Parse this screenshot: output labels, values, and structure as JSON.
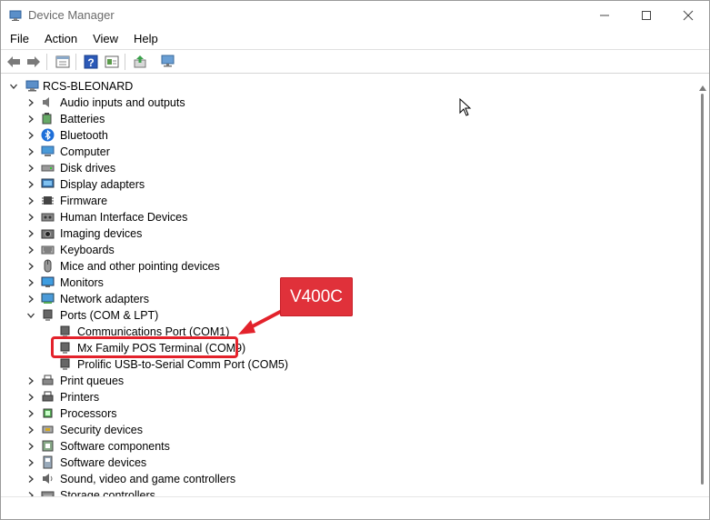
{
  "window": {
    "title": "Device Manager"
  },
  "menu": [
    "File",
    "Action",
    "View",
    "Help"
  ],
  "toolbar_icons": [
    "back-icon",
    "forward-icon",
    "properties-icon",
    "help-icon",
    "show-hidden-icon",
    "update-driver-icon",
    "scan-hardware-icon"
  ],
  "tree": {
    "root": "RCS-BLEONARD",
    "categories": [
      {
        "label": "Audio inputs and outputs",
        "icon": "speaker-icon",
        "expanded": false
      },
      {
        "label": "Batteries",
        "icon": "battery-icon",
        "expanded": false
      },
      {
        "label": "Bluetooth",
        "icon": "bluetooth-icon",
        "expanded": false
      },
      {
        "label": "Computer",
        "icon": "computer-icon",
        "expanded": false
      },
      {
        "label": "Disk drives",
        "icon": "disk-icon",
        "expanded": false
      },
      {
        "label": "Display adapters",
        "icon": "display-adapter-icon",
        "expanded": false
      },
      {
        "label": "Firmware",
        "icon": "chip-icon",
        "expanded": false
      },
      {
        "label": "Human Interface Devices",
        "icon": "hid-icon",
        "expanded": false
      },
      {
        "label": "Imaging devices",
        "icon": "camera-icon",
        "expanded": false
      },
      {
        "label": "Keyboards",
        "icon": "keyboard-icon",
        "expanded": false
      },
      {
        "label": "Mice and other pointing devices",
        "icon": "mouse-icon",
        "expanded": false
      },
      {
        "label": "Monitors",
        "icon": "monitor-icon",
        "expanded": false
      },
      {
        "label": "Network adapters",
        "icon": "network-icon",
        "expanded": false
      },
      {
        "label": "Ports (COM & LPT)",
        "icon": "port-icon",
        "expanded": true,
        "children": [
          "Communications Port (COM1)",
          "Mx Family POS Terminal (COM9)",
          "Prolific USB-to-Serial Comm Port (COM5)"
        ]
      },
      {
        "label": "Print queues",
        "icon": "print-queue-icon",
        "expanded": false
      },
      {
        "label": "Printers",
        "icon": "printer-icon",
        "expanded": false
      },
      {
        "label": "Processors",
        "icon": "processor-icon",
        "expanded": false
      },
      {
        "label": "Security devices",
        "icon": "security-icon",
        "expanded": false
      },
      {
        "label": "Software components",
        "icon": "software-component-icon",
        "expanded": false
      },
      {
        "label": "Software devices",
        "icon": "software-device-icon",
        "expanded": false
      },
      {
        "label": "Sound, video and game controllers",
        "icon": "sound-icon",
        "expanded": false
      },
      {
        "label": "Storage controllers",
        "icon": "storage-icon",
        "expanded": false
      }
    ]
  },
  "annotation": {
    "callout_text": "V400C",
    "color": "#e3222b"
  }
}
